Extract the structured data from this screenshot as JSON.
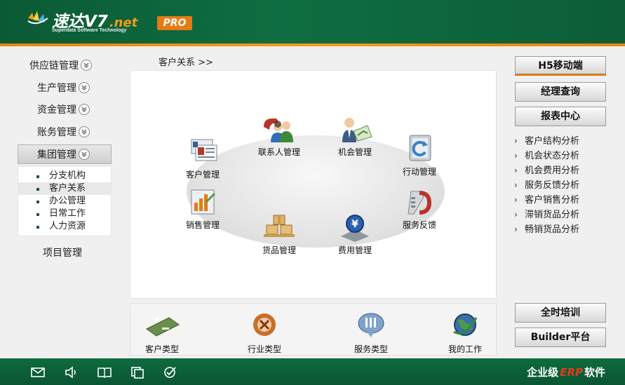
{
  "header": {
    "logo_main": "速达V7",
    "logo_net": ".net",
    "logo_sub": "Superdata Software Technology",
    "pro_badge": "PRO"
  },
  "left_nav": {
    "items": [
      {
        "label": "供应链管理"
      },
      {
        "label": "生产管理"
      },
      {
        "label": "资金管理"
      },
      {
        "label": "账务管理"
      },
      {
        "label": "集团管理"
      }
    ],
    "sub_items": [
      {
        "label": "分支机构"
      },
      {
        "label": "客户关系"
      },
      {
        "label": "办公管理"
      },
      {
        "label": "日常工作"
      },
      {
        "label": "人力资源"
      }
    ],
    "project": "项目管理"
  },
  "breadcrumb": "客户关系  >>",
  "modules": [
    {
      "label": "客户管理",
      "icon": "customer-cards-icon"
    },
    {
      "label": "联系人管理",
      "icon": "contacts-phone-icon"
    },
    {
      "label": "机会管理",
      "icon": "opportunity-person-icon"
    },
    {
      "label": "行动管理",
      "icon": "action-arrow-icon"
    },
    {
      "label": "销售管理",
      "icon": "sales-chart-icon"
    },
    {
      "label": "服务反馈",
      "icon": "service-phone-icon"
    },
    {
      "label": "货品管理",
      "icon": "goods-boxes-icon"
    },
    {
      "label": "费用管理",
      "icon": "expense-yen-icon"
    }
  ],
  "bottom_modules": [
    {
      "label": "客户类型",
      "icon": "customer-type-icon"
    },
    {
      "label": "行业类型",
      "icon": "industry-type-icon"
    },
    {
      "label": "服务类型",
      "icon": "service-type-icon"
    },
    {
      "label": "我的工作",
      "icon": "my-work-globe-icon"
    }
  ],
  "right": {
    "h5": "H5移动端",
    "manager_query": "经理查询",
    "report_center": "报表中心",
    "reports": [
      "客户结构分析",
      "机会状态分析",
      "机会费用分析",
      "服务反馈分析",
      "客户销售分析",
      "滞销货品分析",
      "畅销货品分析"
    ],
    "training": "全时培训",
    "builder": "Builder平台"
  },
  "footer": {
    "brand_pre": "企业级",
    "brand_erp": "ERP",
    "brand_post": "软件",
    "icons": [
      "mail-icon",
      "speaker-icon",
      "book-icon",
      "copy-icon",
      "check-icon"
    ]
  },
  "colors": {
    "header_green": "#0f6e41",
    "accent_orange": "#f39b1c",
    "erp_red": "#e23b1e"
  }
}
